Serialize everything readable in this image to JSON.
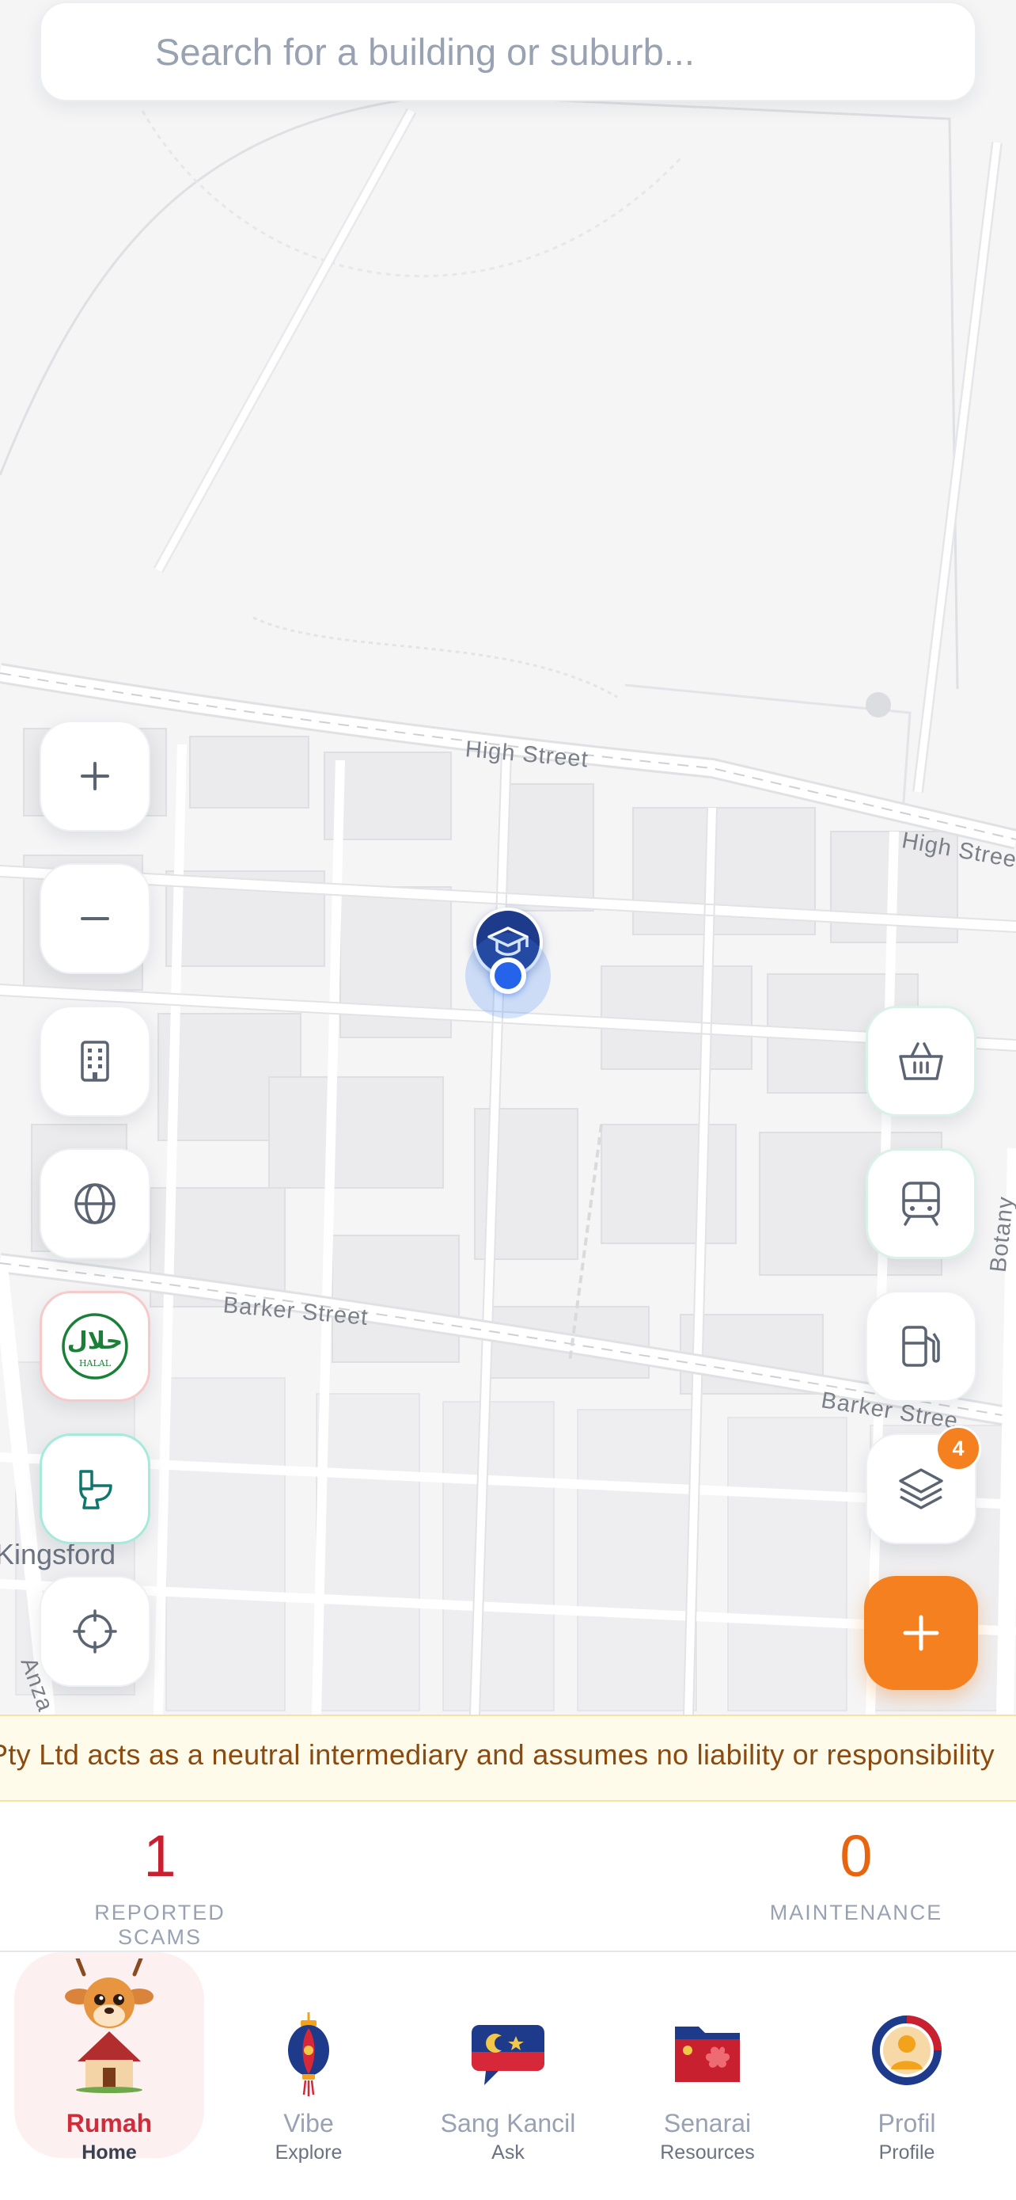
{
  "search": {
    "placeholder": "Search for a building or suburb..."
  },
  "map": {
    "streets": {
      "high_1": "High Street",
      "high_2": "High Stree",
      "barker_1": "Barker Street",
      "barker_2": "Barker Stree",
      "botany": "Botany",
      "anzac": "Anza"
    },
    "suburb": "Kingsford",
    "controls_left": [
      {
        "name": "zoom-in",
        "icon": "plus-icon"
      },
      {
        "name": "zoom-out",
        "icon": "minus-icon"
      },
      {
        "name": "buildings",
        "icon": "building-icon"
      },
      {
        "name": "globe",
        "icon": "globe-icon"
      },
      {
        "name": "halal",
        "icon": "halal-icon",
        "icon_text_arabic": "حلال",
        "icon_text": "HALAL"
      },
      {
        "name": "toilet",
        "icon": "toilet-icon"
      },
      {
        "name": "locate",
        "icon": "crosshair-icon"
      }
    ],
    "controls_right": [
      {
        "name": "grocery",
        "icon": "basket-icon"
      },
      {
        "name": "transit",
        "icon": "train-icon"
      },
      {
        "name": "fuel",
        "icon": "fuel-icon"
      },
      {
        "name": "layers",
        "icon": "layers-icon",
        "badge": "4"
      },
      {
        "name": "add",
        "icon": "plus-icon"
      }
    ],
    "colors": {
      "accent": "#f4801f",
      "pin": "#1e3a8a",
      "location": "#2563eb",
      "halal": "#1a7f37",
      "toilet": "#0f766e"
    }
  },
  "ticker": {
    "text": "Pty Ltd acts as a neutral intermediary and assumes no liability or responsibility"
  },
  "stats": {
    "scams": {
      "value": "1",
      "label": "REPORTED SCAMS",
      "color": "#c8202f"
    },
    "maintenance": {
      "value": "0",
      "label": "MAINTENANCE",
      "color": "#e8650f"
    }
  },
  "nav": [
    {
      "label": "Rumah",
      "sub": "Home",
      "icon": "deer-house-icon",
      "active": true
    },
    {
      "label": "Vibe",
      "sub": "Explore",
      "icon": "lantern-icon",
      "active": false
    },
    {
      "label": "Sang Kancil",
      "sub": "Ask",
      "icon": "chat-bubble-icon",
      "active": false
    },
    {
      "label": "Senarai",
      "sub": "Resources",
      "icon": "folder-icon",
      "active": false
    },
    {
      "label": "Profil",
      "sub": "Profile",
      "icon": "profile-badge-icon",
      "active": false
    }
  ]
}
